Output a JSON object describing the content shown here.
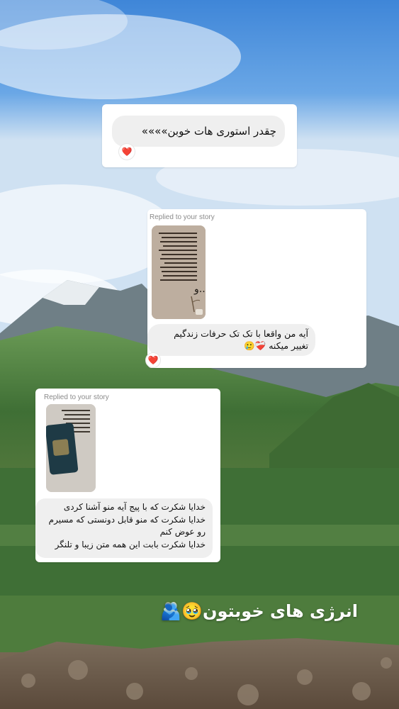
{
  "messages": [
    {
      "text": "چقدر استوری هات خوبن»»»»",
      "reaction": "❤️"
    },
    {
      "replied_label": "Replied to your story",
      "text": "آیه من واقعا با تک تک حرفات زندگیم تغییر میکنه ❤️‍🩹🥲",
      "reaction": "❤️"
    },
    {
      "replied_label": "Replied to your story",
      "lines": [
        "خدایا شکرت که با پیج آیه منو آشنا کردی",
        "خدایا شکرت که منو قابل دونستی که مسیرم رو عوض کنم",
        "خدایا شکرت بابت این همه متن زیبا و تلنگر"
      ]
    }
  ],
  "caption": "انرژی های خوبتون🥹🫂",
  "colors": {
    "sky": "#4a8fdc",
    "card": "#ffffff",
    "bubble": "#efefef",
    "text": "#111111",
    "muted": "#8a8a8a"
  }
}
